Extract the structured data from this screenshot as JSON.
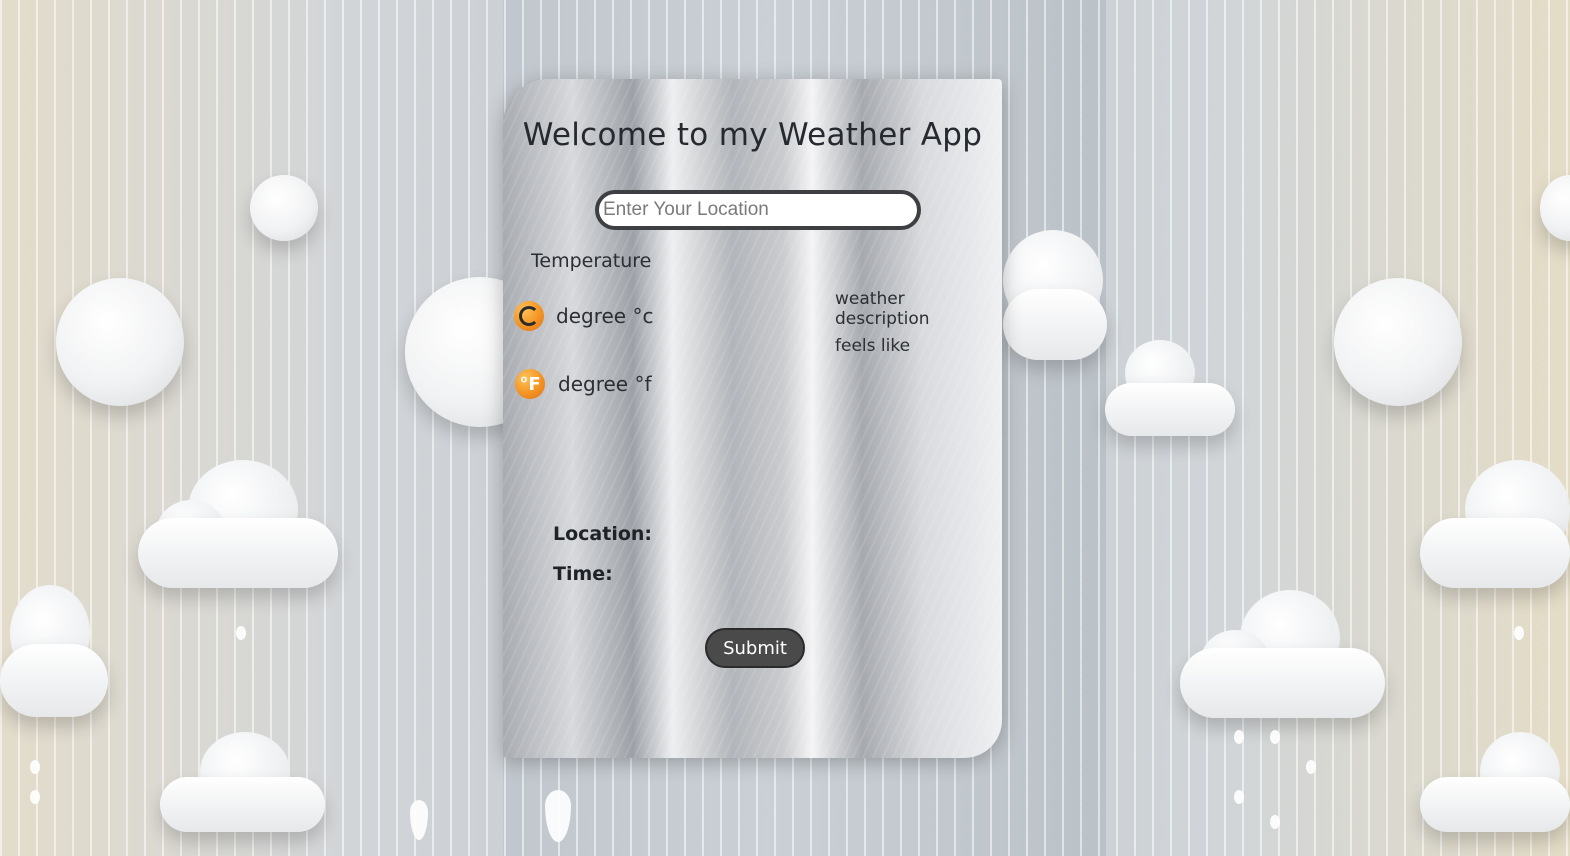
{
  "app": {
    "title": "Welcome to my Weather App"
  },
  "search": {
    "placeholder": "Enter Your Location",
    "value": ""
  },
  "temperature": {
    "heading": "Temperature",
    "celsius_label": "degree °c",
    "fahrenheit_label": "degree °f",
    "celsius_icon": "celsius-icon",
    "fahrenheit_icon": "fahrenheit-icon",
    "fahrenheit_icon_glyph": "°F"
  },
  "weather": {
    "description_label": "weather description",
    "feels_like_label": "feels like"
  },
  "info": {
    "location_label": "Location:",
    "time_label": "Time:"
  },
  "actions": {
    "submit_label": "Submit"
  },
  "colors": {
    "icon_orange": "#f39422",
    "submit_bg": "#4a4a4b",
    "input_border": "#3e3f42",
    "text_dark": "#262a30"
  }
}
